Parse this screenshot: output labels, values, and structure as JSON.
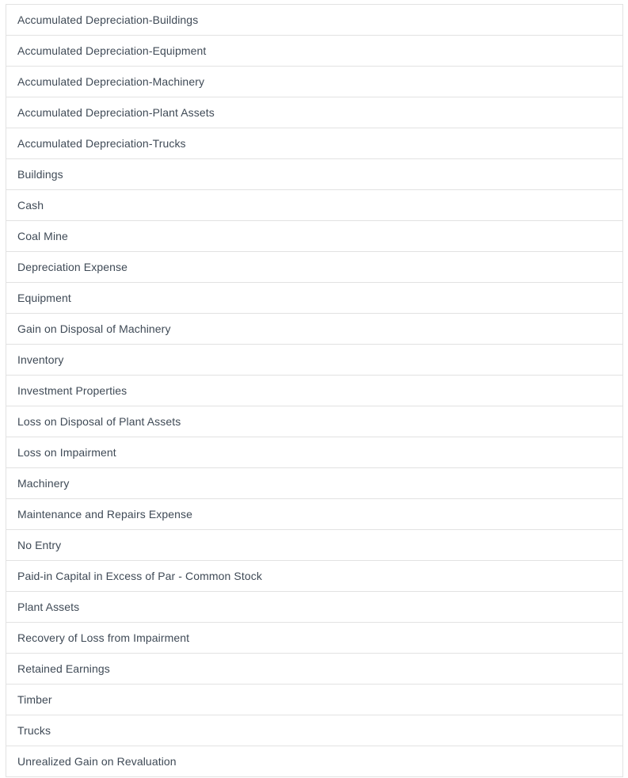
{
  "list": {
    "name": "account-options-list",
    "colors": {
      "background": "#ffffff",
      "border": "#e2e2e2",
      "text": "#3f4a56"
    },
    "items": [
      {
        "label": "Accumulated Depreciation-Buildings"
      },
      {
        "label": "Accumulated Depreciation-Equipment"
      },
      {
        "label": "Accumulated Depreciation-Machinery"
      },
      {
        "label": "Accumulated Depreciation-Plant Assets"
      },
      {
        "label": "Accumulated Depreciation-Trucks"
      },
      {
        "label": "Buildings"
      },
      {
        "label": "Cash"
      },
      {
        "label": "Coal Mine"
      },
      {
        "label": "Depreciation Expense"
      },
      {
        "label": "Equipment"
      },
      {
        "label": "Gain on Disposal of Machinery"
      },
      {
        "label": "Inventory"
      },
      {
        "label": "Investment Properties"
      },
      {
        "label": "Loss on Disposal of Plant Assets"
      },
      {
        "label": "Loss on Impairment"
      },
      {
        "label": "Machinery"
      },
      {
        "label": "Maintenance and Repairs Expense"
      },
      {
        "label": "No Entry"
      },
      {
        "label": "Paid-in Capital in Excess of Par - Common Stock"
      },
      {
        "label": "Plant Assets"
      },
      {
        "label": "Recovery of Loss from Impairment"
      },
      {
        "label": "Retained Earnings"
      },
      {
        "label": "Timber"
      },
      {
        "label": "Trucks"
      },
      {
        "label": "Unrealized Gain on Revaluation"
      }
    ]
  }
}
